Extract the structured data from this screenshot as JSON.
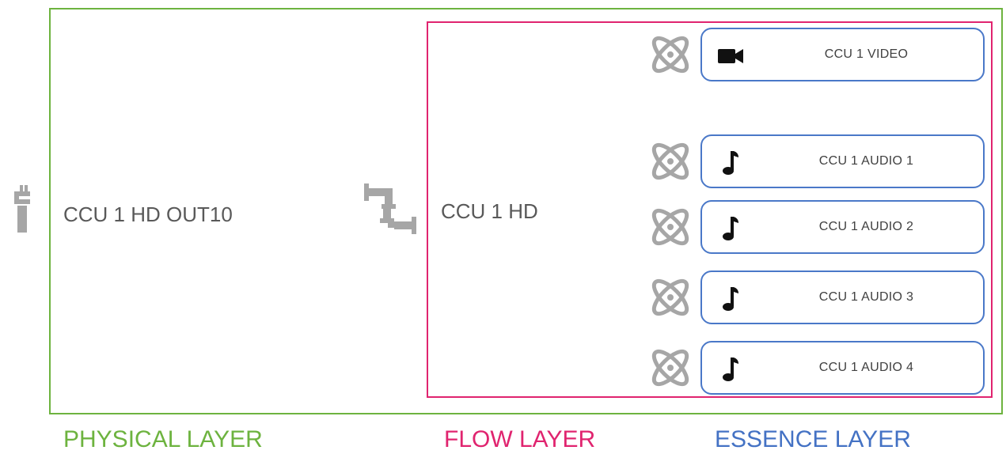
{
  "physical": {
    "name": "CCU 1 HD OUT10",
    "layer_label": "PHYSICAL LAYER"
  },
  "flow": {
    "name": "CCU 1 HD",
    "layer_label": "FLOW LAYER"
  },
  "essence": {
    "layer_label": "ESSENCE LAYER",
    "items": [
      {
        "label": "CCU 1 VIDEO",
        "icon": "video-camera-icon"
      },
      {
        "label": "CCU 1 AUDIO 1",
        "icon": "music-note-icon"
      },
      {
        "label": "CCU 1 AUDIO 2",
        "icon": "music-note-icon"
      },
      {
        "label": "CCU 1 AUDIO 3",
        "icon": "music-note-icon"
      },
      {
        "label": "CCU 1 AUDIO 4",
        "icon": "music-note-icon"
      }
    ]
  },
  "icons": {
    "physical": "connector-plug-icon",
    "flow": "pipe-flow-icon",
    "essence_source": "atom-icon"
  },
  "colors": {
    "physical": "#6db33f",
    "flow": "#e0246f",
    "essence": "#4472c4",
    "icon_gray": "#a6a6a6"
  }
}
